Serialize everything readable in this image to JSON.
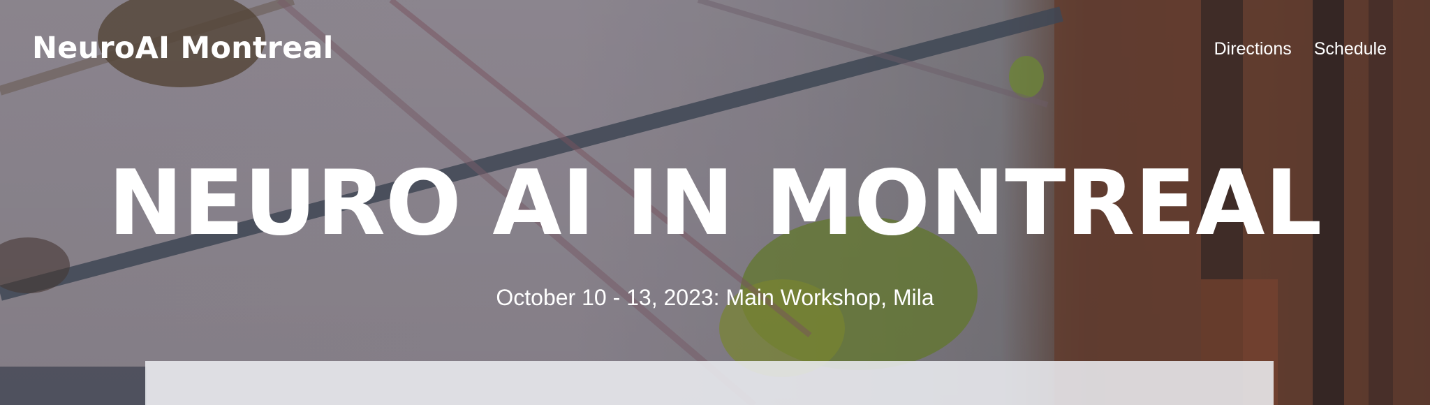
{
  "header": {
    "site_title": "NeuroAI Montreal",
    "nav": [
      {
        "label": "Directions"
      },
      {
        "label": "Schedule"
      }
    ]
  },
  "hero": {
    "headline": "NEURO AI IN MONTREAL",
    "subtitle": "October 10 - 13, 2023: Main Workshop, Mila"
  },
  "colors": {
    "text": "#ffffff",
    "card": "#ebecf0"
  }
}
